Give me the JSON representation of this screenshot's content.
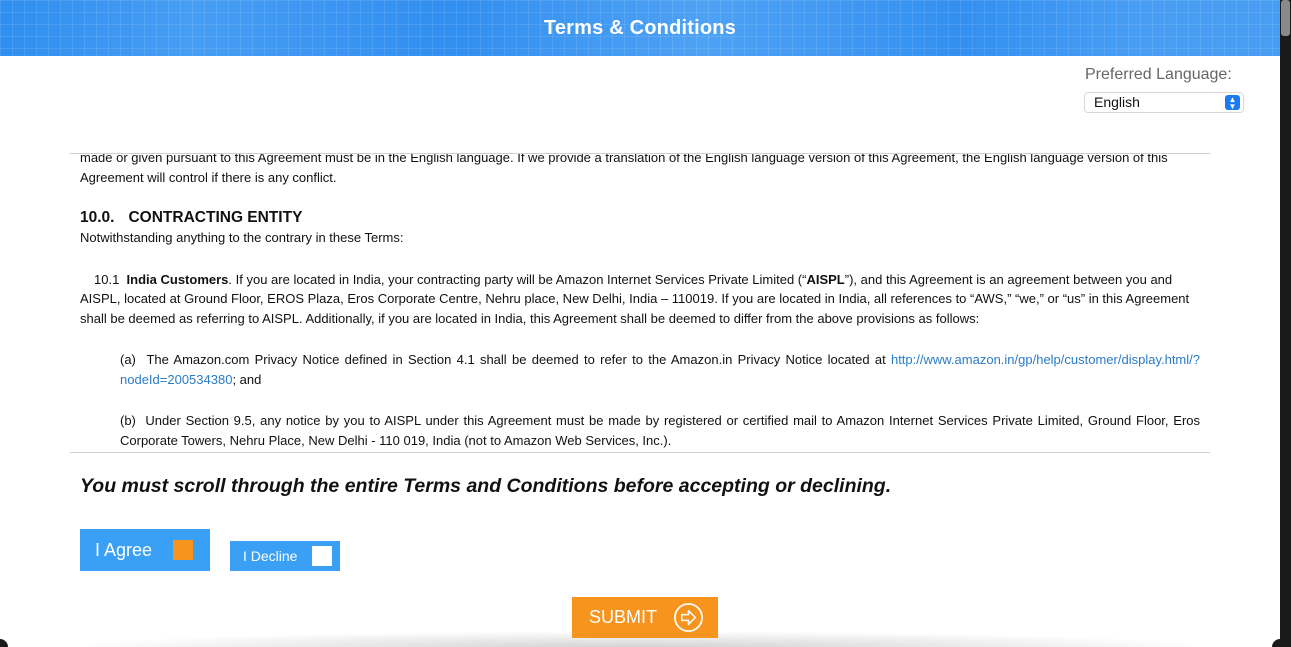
{
  "header": {
    "title": "Terms & Conditions"
  },
  "language": {
    "label": "Preferred Language:",
    "selected": "English"
  },
  "terms": {
    "intro_fragment": "made or given pursuant to this Agreement must be in the English language.  If we provide a translation of the English language version of this Agreement, the English language version of this Agreement will control if there is any conflict.",
    "section_number": "10.0.",
    "section_title": "CONTRACTING ENTITY",
    "section_intro": "Notwithstanding anything to the contrary in these Terms:",
    "clause_10_1": {
      "number": "10.1",
      "title": "India Customers",
      "text_before": ".  If you are located in India, your contracting party will be Amazon Internet Services Private Limited (“",
      "aispl": "AISPL",
      "text_after": "”), and this Agreement is an agreement between you and AISPL, located at Ground Floor, EROS Plaza, Eros Corporate Centre, Nehru place, New Delhi, India – 110019.  If you are located in India, all references to “AWS,” “we,” or “us” in this Agreement shall be deemed as referring to AISPL.  Additionally, if you are located in India, this Agreement shall be deemed to differ from the above provisions as follows:"
    },
    "item_a": {
      "label": "(a)",
      "text": "The Amazon.com Privacy Notice defined in Section 4.1 shall be deemed to refer to the Amazon.in Privacy Notice located at ",
      "link": "http://www.amazon.in/gp/help/customer/display.html/?nodeId=200534380",
      "suffix": "; and"
    },
    "item_b": {
      "label": "(b)",
      "text": "Under Section 9.5, any notice by you to AISPL under this Agreement must be made by registered or certified mail to Amazon Internet Services Private Limited, Ground Floor, Eros Corporate Towers, Nehru Place, New Delhi - 110 019, India (not to Amazon Web Services, Inc.)."
    }
  },
  "scroll_message": "You must scroll through the entire Terms and Conditions before accepting or declining.",
  "buttons": {
    "agree": "I Agree",
    "decline": "I Decline",
    "submit": "SUBMIT"
  },
  "colors": {
    "header_blue": "#2f8ff0",
    "button_blue": "#3aa0f5",
    "accent_orange": "#f7941d",
    "link_blue": "#2a7bc8"
  },
  "icons": {
    "submit": "arrow-circle-right-icon",
    "select": "select-arrows-icon"
  }
}
